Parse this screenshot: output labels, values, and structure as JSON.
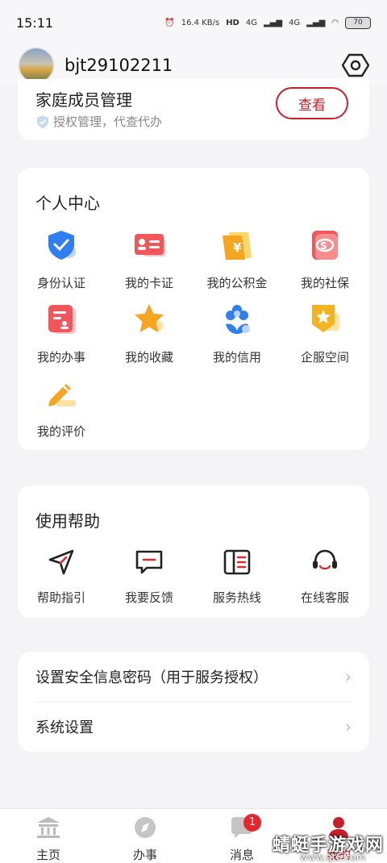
{
  "status_bar": {
    "time": "15:11",
    "net_speed": "16.4 KB/s",
    "signal1": "4G",
    "signal2": "4G",
    "battery": "70"
  },
  "profile": {
    "username": "bjt29102211"
  },
  "family": {
    "title": "家庭成员管理",
    "subtitle": "授权管理，代查代办",
    "button": "查看"
  },
  "personal": {
    "title": "个人中心",
    "items": [
      {
        "label": "身份认证",
        "icon": "shield-check-icon"
      },
      {
        "label": "我的卡证",
        "icon": "id-card-icon"
      },
      {
        "label": "我的公积金",
        "icon": "yuan-folder-icon"
      },
      {
        "label": "我的社保",
        "icon": "social-security-icon"
      },
      {
        "label": "我的办事",
        "icon": "document-icon"
      },
      {
        "label": "我的收藏",
        "icon": "star-icon"
      },
      {
        "label": "我的信用",
        "icon": "flower-icon"
      },
      {
        "label": "企服空间",
        "icon": "badge-star-icon"
      },
      {
        "label": "我的评价",
        "icon": "pencil-icon"
      }
    ]
  },
  "help": {
    "title": "使用帮助",
    "items": [
      {
        "label": "帮助指引",
        "icon": "navigation-arrow-icon"
      },
      {
        "label": "我要反馈",
        "icon": "feedback-icon"
      },
      {
        "label": "服务热线",
        "icon": "hotline-book-icon"
      },
      {
        "label": "在线客服",
        "icon": "headset-icon"
      }
    ]
  },
  "settings": {
    "security": "设置安全信息密码（用于服务授权）",
    "system": "系统设置"
  },
  "tabbar": {
    "tabs": [
      {
        "label": "主页",
        "icon": "temple-icon"
      },
      {
        "label": "办事",
        "icon": "compass-icon"
      },
      {
        "label": "消息",
        "icon": "chat-icon",
        "badge": "1"
      },
      {
        "label": "我的",
        "icon": "user-icon"
      }
    ]
  },
  "watermark": {
    "text": "蜻蜓手游戏网",
    "url": "www.qt6.com"
  },
  "colors": {
    "accent": "#c8202a",
    "badge": "#e4262d"
  }
}
